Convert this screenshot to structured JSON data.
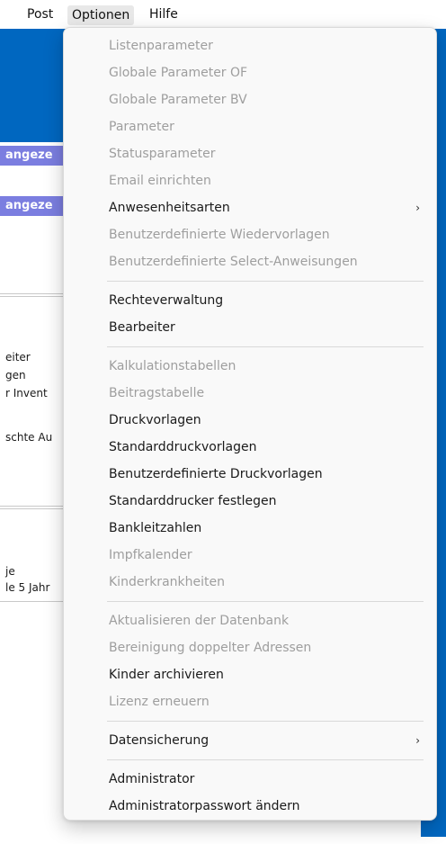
{
  "menubar": {
    "items": [
      {
        "label": "Post"
      },
      {
        "label": "Optionen"
      },
      {
        "label": "Hilfe"
      }
    ]
  },
  "background": {
    "banners": [
      "angeze",
      "angeze"
    ],
    "lines": [
      "eiter",
      "gen",
      "r Invent",
      "schte Au",
      "je",
      "le 5 Jahr"
    ]
  },
  "menu": {
    "items": [
      {
        "label": "Listenparameter",
        "enabled": false
      },
      {
        "label": "Globale Parameter OF",
        "enabled": false
      },
      {
        "label": "Globale Parameter BV",
        "enabled": false
      },
      {
        "label": "Parameter",
        "enabled": false
      },
      {
        "label": "Statusparameter",
        "enabled": false
      },
      {
        "label": "Email einrichten",
        "enabled": false
      },
      {
        "label": "Anwesenheitsarten",
        "enabled": true,
        "submenu": true
      },
      {
        "label": "Benutzerdefinierte Wiedervorlagen",
        "enabled": false
      },
      {
        "label": "Benutzerdefinierte Select-Anweisungen",
        "enabled": false
      },
      {
        "label": "Rechteverwaltung",
        "enabled": true
      },
      {
        "label": "Bearbeiter",
        "enabled": true
      },
      {
        "label": "Kalkulationstabellen",
        "enabled": false
      },
      {
        "label": "Beitragstabelle",
        "enabled": false
      },
      {
        "label": "Druckvorlagen",
        "enabled": true
      },
      {
        "label": "Standarddruckvorlagen",
        "enabled": true
      },
      {
        "label": "Benutzerdefinierte Druckvorlagen",
        "enabled": true
      },
      {
        "label": "Standarddrucker festlegen",
        "enabled": true
      },
      {
        "label": "Bankleitzahlen",
        "enabled": true
      },
      {
        "label": "Impfkalender",
        "enabled": false
      },
      {
        "label": "Kinderkrankheiten",
        "enabled": false
      },
      {
        "label": "Aktualisieren der Datenbank",
        "enabled": false
      },
      {
        "label": "Bereinigung doppelter Adressen",
        "enabled": false
      },
      {
        "label": "Kinder archivieren",
        "enabled": true
      },
      {
        "label": "Lizenz erneuern",
        "enabled": false
      },
      {
        "label": "Datensicherung",
        "enabled": true,
        "submenu": true
      },
      {
        "label": "Administrator",
        "enabled": true
      },
      {
        "label": "Administratorpasswort ändern",
        "enabled": true
      }
    ],
    "submenu_glyph": "›"
  },
  "colors": {
    "accent_blue": "#0067c0",
    "banner": "#7b7ee0",
    "disabled_text": "#9e9e9e"
  }
}
